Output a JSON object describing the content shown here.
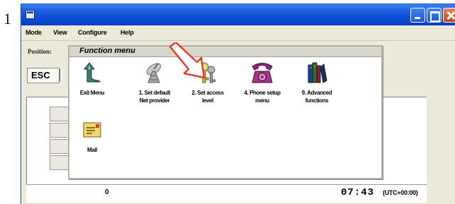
{
  "step": {
    "number": "1"
  },
  "window": {
    "controls": {
      "minimize": "minimize-icon",
      "maximize": "maximize-icon",
      "close": "close-icon"
    }
  },
  "menubar": {
    "items": [
      "Mode",
      "View",
      "Configure",
      "Help"
    ]
  },
  "toolbar": {
    "position_label": "Position:",
    "esc_label": "ESC"
  },
  "function_menu": {
    "title": "Function menu",
    "items": [
      {
        "label": "Exit Menu",
        "icon": "exit-arrow-icon"
      },
      {
        "label": "1.  Set default\nNet provider",
        "icon": "satellite-dish-icon"
      },
      {
        "label": "2.  Set access\nlevel",
        "icon": "key-icon"
      },
      {
        "label": "4.  Phone setup\nmenu",
        "icon": "telephone-icon"
      },
      {
        "label": "9.  Advanced\nfunctions",
        "icon": "books-icon"
      },
      {
        "label": "Mail",
        "icon": "mail-icon"
      }
    ]
  },
  "status": {
    "counter": "0",
    "time": "07:43",
    "timezone": "(UTC+00:00)"
  },
  "colors": {
    "titlebar": "#0a49d4",
    "arrow": "#e8392a",
    "panel": "#ece9d8"
  }
}
